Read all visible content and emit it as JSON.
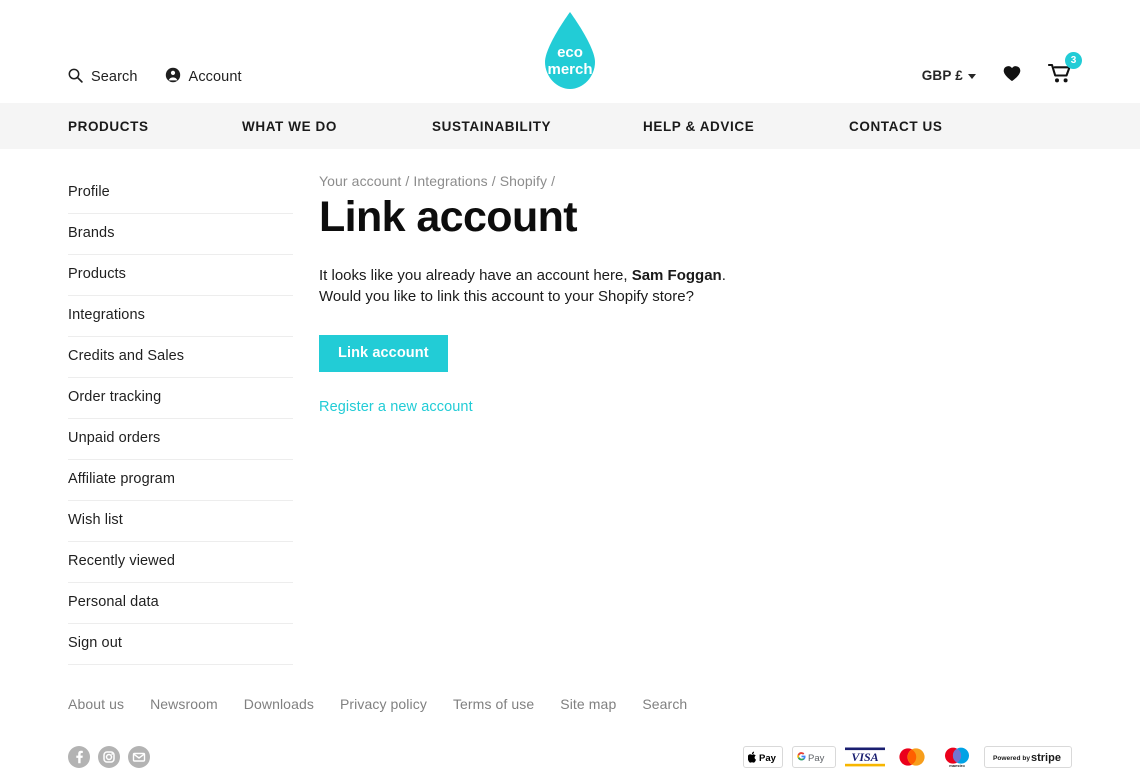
{
  "brand": {
    "logo_text_line1": "eco",
    "logo_text_line2": "merch",
    "accent_color": "#22ccd6",
    "nav_bg_color": "#f5f5f5"
  },
  "utility": {
    "search_label": "Search",
    "account_label": "Account",
    "search_icon": "search-icon",
    "account_icon": "account-icon",
    "currency_label": "GBP £",
    "wishlist_icon": "heart-icon",
    "cart_icon": "cart-icon",
    "cart_count": "3"
  },
  "mainnav": {
    "items": [
      {
        "label": "PRODUCTS"
      },
      {
        "label": "WHAT WE DO"
      },
      {
        "label": "SUSTAINABILITY"
      },
      {
        "label": "HELP & ADVICE"
      },
      {
        "label": "CONTACT US"
      }
    ]
  },
  "sidebar": {
    "items": [
      {
        "label": "Profile"
      },
      {
        "label": "Brands"
      },
      {
        "label": "Products"
      },
      {
        "label": "Integrations"
      },
      {
        "label": "Credits and Sales"
      },
      {
        "label": "Order tracking"
      },
      {
        "label": "Unpaid orders"
      },
      {
        "label": "Affiliate program"
      },
      {
        "label": "Wish list"
      },
      {
        "label": "Recently viewed"
      },
      {
        "label": "Personal data"
      },
      {
        "label": "Sign out"
      }
    ]
  },
  "main": {
    "breadcrumb": "Your account / Integrations / Shopify /",
    "title": "Link account",
    "intro_line1_pre": "It looks like you already have an account here, ",
    "intro_user_name": "Sam Foggan",
    "intro_line1_post": ".",
    "intro_line2": "Would you like to link this account to your Shopify store?",
    "primary_button": "Link account",
    "alt_link": "Register a new account"
  },
  "footer": {
    "links": [
      {
        "label": "About us"
      },
      {
        "label": "Newsroom"
      },
      {
        "label": "Downloads"
      },
      {
        "label": "Privacy policy"
      },
      {
        "label": "Terms of use"
      },
      {
        "label": "Site map"
      },
      {
        "label": "Search"
      }
    ],
    "socials": [
      {
        "name": "facebook-icon",
        "glyph": "f"
      },
      {
        "name": "instagram-icon",
        "glyph": "◎"
      },
      {
        "name": "email-icon",
        "glyph": "✉"
      }
    ],
    "payments": [
      {
        "name": "apple-pay-badge",
        "label": "Pay"
      },
      {
        "name": "google-pay-badge",
        "label": "Pay"
      },
      {
        "name": "visa-badge",
        "label": "VISA"
      },
      {
        "name": "mastercard-badge",
        "label": ""
      },
      {
        "name": "maestro-badge",
        "label": "maestro"
      },
      {
        "name": "stripe-badge",
        "label_small": "Powered by",
        "label": "stripe"
      }
    ]
  }
}
